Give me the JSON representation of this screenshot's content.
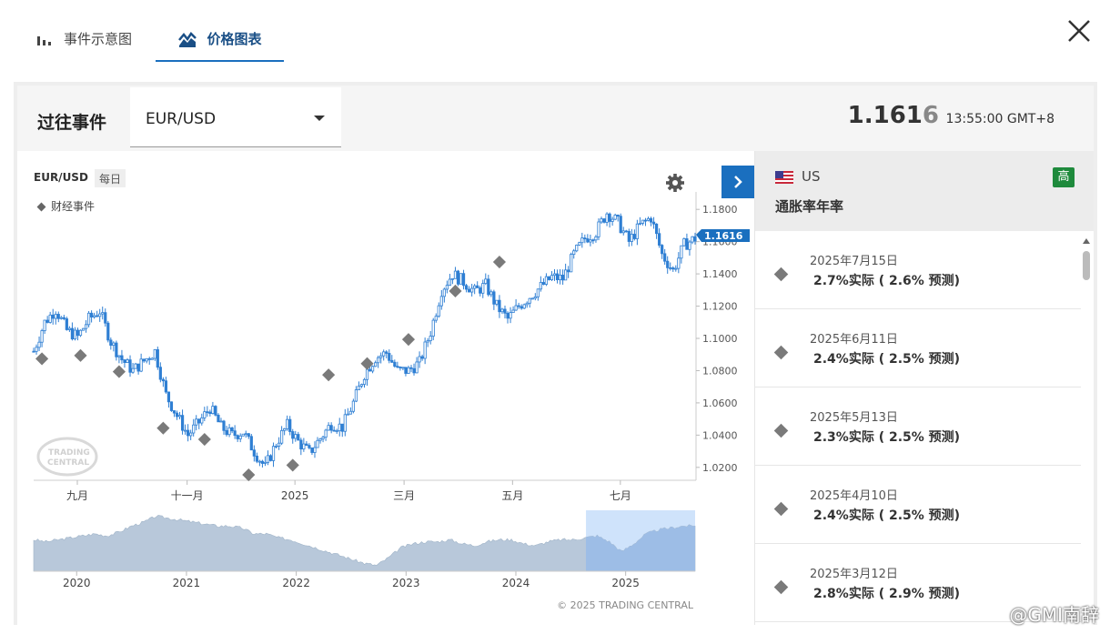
{
  "tabs": [
    {
      "label": "事件示意图",
      "icon": "bar-chart-icon"
    },
    {
      "label": "价格图表",
      "icon": "price-chart-icon",
      "active": true
    }
  ],
  "header": {
    "section_label": "过往事件",
    "instrument": "EUR/USD",
    "price_main": "1.161",
    "price_last_digit": "6",
    "time": "13:55:00 GMT+8"
  },
  "chart": {
    "symbol": "EUR/USD",
    "interval": "每日",
    "legend_events": "财经事件",
    "current_price_label": "1.1616",
    "logo_text_1": "TRADING",
    "logo_text_2": "CENTRAL",
    "copyright": "© 2025 TRADING CENTRAL"
  },
  "chart_data": [
    {
      "type": "candlestick",
      "title": "",
      "y_ticks": [
        "1.1800",
        "1.1600",
        "1.1400",
        "1.1200",
        "1.1000",
        "1.0800",
        "1.0600",
        "1.0400",
        "1.0200"
      ],
      "x_ticks": [
        "九月",
        "十一月",
        "2025",
        "三月",
        "五月",
        "七月"
      ],
      "ylim": [
        1.012,
        1.188
      ],
      "close_path": [
        [
          0,
          1.092
        ],
        [
          4,
          1.11
        ],
        [
          8,
          1.118
        ],
        [
          12,
          1.105
        ],
        [
          16,
          1.101
        ],
        [
          20,
          1.112
        ],
        [
          24,
          1.117
        ],
        [
          28,
          1.098
        ],
        [
          32,
          1.087
        ],
        [
          36,
          1.08
        ],
        [
          40,
          1.086
        ],
        [
          44,
          1.092
        ],
        [
          48,
          1.065
        ],
        [
          52,
          1.052
        ],
        [
          56,
          1.04
        ],
        [
          60,
          1.048
        ],
        [
          64,
          1.057
        ],
        [
          68,
          1.045
        ],
        [
          72,
          1.04
        ],
        [
          76,
          1.042
        ],
        [
          80,
          1.03
        ],
        [
          84,
          1.02
        ],
        [
          88,
          1.035
        ],
        [
          92,
          1.046
        ],
        [
          96,
          1.036
        ],
        [
          100,
          1.029
        ],
        [
          104,
          1.038
        ],
        [
          108,
          1.047
        ],
        [
          112,
          1.045
        ],
        [
          116,
          1.06
        ],
        [
          120,
          1.078
        ],
        [
          124,
          1.088
        ],
        [
          128,
          1.091
        ],
        [
          132,
          1.08
        ],
        [
          136,
          1.08
        ],
        [
          140,
          1.085
        ],
        [
          144,
          1.104
        ],
        [
          148,
          1.13
        ],
        [
          152,
          1.14
        ],
        [
          156,
          1.135
        ],
        [
          160,
          1.129
        ],
        [
          164,
          1.133
        ],
        [
          168,
          1.12
        ],
        [
          172,
          1.112
        ],
        [
          176,
          1.12
        ],
        [
          180,
          1.126
        ],
        [
          184,
          1.132
        ],
        [
          188,
          1.138
        ],
        [
          192,
          1.137
        ],
        [
          196,
          1.152
        ],
        [
          200,
          1.162
        ],
        [
          204,
          1.166
        ],
        [
          208,
          1.178
        ],
        [
          212,
          1.172
        ],
        [
          216,
          1.16
        ],
        [
          220,
          1.17
        ],
        [
          224,
          1.175
        ],
        [
          228,
          1.152
        ],
        [
          232,
          1.142
        ],
        [
          236,
          1.158
        ],
        [
          240,
          1.162
        ]
      ],
      "event_markers": [
        [
          3,
          1.093
        ],
        [
          17,
          1.095
        ],
        [
          31,
          1.085
        ],
        [
          47,
          1.05
        ],
        [
          62,
          1.043
        ],
        [
          78,
          1.021
        ],
        [
          94,
          1.027
        ],
        [
          107,
          1.083
        ],
        [
          121,
          1.09
        ],
        [
          136,
          1.105
        ],
        [
          153,
          1.135
        ],
        [
          169,
          1.153
        ]
      ]
    },
    {
      "type": "area",
      "title": "",
      "x_ticks": [
        "2020",
        "2021",
        "2022",
        "2023",
        "2024",
        "2025"
      ],
      "values": [
        1.1,
        1.09,
        1.1,
        1.11,
        1.12,
        1.13,
        1.12,
        1.14,
        1.17,
        1.19,
        1.22,
        1.21,
        1.2,
        1.19,
        1.18,
        1.17,
        1.17,
        1.16,
        1.13,
        1.13,
        1.11,
        1.1,
        1.08,
        1.06,
        1.04,
        1.02,
        1.0,
        0.98,
        0.97,
        1.01,
        1.06,
        1.08,
        1.09,
        1.09,
        1.1,
        1.08,
        1.07,
        1.09,
        1.1,
        1.1,
        1.08,
        1.07,
        1.09,
        1.1,
        1.1,
        1.11,
        1.12,
        1.09,
        1.04,
        1.08,
        1.13,
        1.15,
        1.16,
        1.17,
        1.17
      ],
      "range_highlight": [
        0.835,
        1.0
      ]
    }
  ],
  "events_panel": {
    "country": "US",
    "title": "通胀率年率",
    "importance": "高",
    "items": [
      {
        "date": "2025年7月15日",
        "result": "2.7%实际 ( 2.6% 预测)"
      },
      {
        "date": "2025年6月11日",
        "result": "2.4%实际 ( 2.5% 预测)"
      },
      {
        "date": "2025年5月13日",
        "result": "2.3%实际 ( 2.5% 预测)"
      },
      {
        "date": "2025年4月10日",
        "result": "2.4%实际 ( 2.5% 预测)"
      },
      {
        "date": "2025年3月12日",
        "result": "2.8%实际 ( 2.9% 预测)"
      }
    ]
  },
  "watermark": "@GMI南辞",
  "colors": {
    "accent": "#1a6fbf",
    "importance_high": "#1e8a3c",
    "candle": "#2f7fd3"
  }
}
